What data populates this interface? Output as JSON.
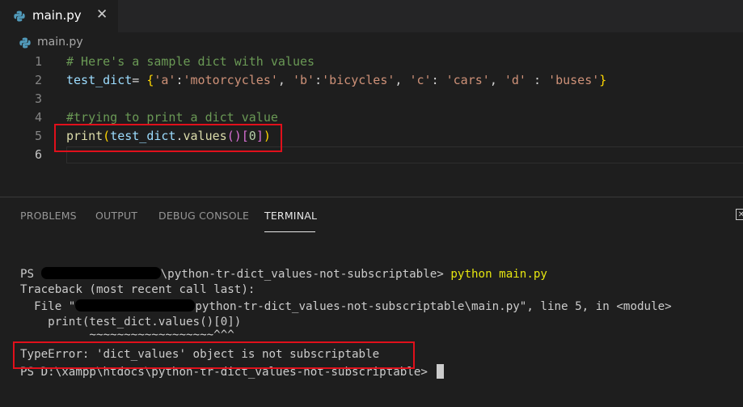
{
  "tab": {
    "title": "main.py",
    "close": "✕",
    "icon": "python-icon"
  },
  "breadcrumb": {
    "file": "main.py"
  },
  "editor": {
    "line_numbers": [
      "1",
      "2",
      "3",
      "4",
      "5",
      "6"
    ],
    "line1": "# Here's a sample dict with values",
    "line2": {
      "var": "test_dict",
      "eq": "= ",
      "open": "{",
      "k1": "'a'",
      "c1": ":",
      "v1": "'motorcycles'",
      "s1": ", ",
      "k2": "'b'",
      "c2": ":",
      "v2": "'bicycles'",
      "s2": ", ",
      "k3": "'c'",
      "c3": ": ",
      "v3": "'cars'",
      "s3": ", ",
      "k4": "'d'",
      "c4": " : ",
      "v4": "'buses'",
      "close": "}"
    },
    "line4": "#trying to print a dict value",
    "line5": {
      "fn": "print",
      "p_open": "(",
      "var": "test_dict",
      "dot": ".",
      "method": "values",
      "call": "()",
      "idx_open": "[",
      "idx": "0",
      "idx_close": "]",
      "p_close": ")"
    }
  },
  "panel": {
    "tabs": [
      "PROBLEMS",
      "OUTPUT",
      "DEBUG CONSOLE",
      "TERMINAL"
    ],
    "active_tab": "TERMINAL"
  },
  "terminal": {
    "l1_prefix": "PS ",
    "l1_path": "\\python-tr-dict_values-not-subscriptable> ",
    "l1_cmd": "python main.py",
    "l2": "Traceback (most recent call last):",
    "l3_prefix": "  File \"",
    "l3_rest": "python-tr-dict_values-not-subscriptable\\main.py\", line 5, in <module>",
    "l4": "    print(test_dict.values()[0])",
    "l5": "          ~~~~~~~~~~~~~~~~~~^^^",
    "l6": "TypeError: 'dict_values' object is not subscriptable",
    "l7": "PS D:\\xampp\\htdocs\\python-tr-dict_values-not-subscriptable> "
  }
}
